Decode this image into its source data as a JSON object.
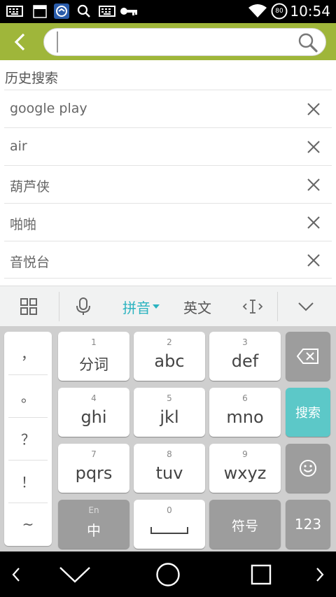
{
  "status_bar": {
    "time": "10:54",
    "battery_level": "80",
    "left_icons": [
      "keyboard-icon",
      "calendar-365-icon",
      "app-notification-icon",
      "search-icon",
      "keyboard-icon",
      "key-icon"
    ],
    "right_icons": [
      "wifi-icon",
      "battery-icon"
    ],
    "calendar_label": "365"
  },
  "header": {
    "bg_color": "#9fb63a",
    "search_value": "",
    "search_placeholder": ""
  },
  "history": {
    "title": "历史搜索",
    "items": [
      {
        "label": "google play"
      },
      {
        "label": "air"
      },
      {
        "label": "葫芦侠"
      },
      {
        "label": "啪啪"
      },
      {
        "label": "音悦台"
      }
    ]
  },
  "keyboard": {
    "toolbar": {
      "pinyin": "拼音",
      "english": "英文",
      "accent_color": "#2bb3c0"
    },
    "symbols": [
      "，",
      "。",
      "？",
      "！",
      "~"
    ],
    "keys": [
      {
        "num": "1",
        "label": "分词"
      },
      {
        "num": "2",
        "label": "abc"
      },
      {
        "num": "3",
        "label": "def"
      },
      {
        "num": "4",
        "label": "ghi"
      },
      {
        "num": "5",
        "label": "jkl"
      },
      {
        "num": "6",
        "label": "mno"
      },
      {
        "num": "7",
        "label": "pqrs"
      },
      {
        "num": "8",
        "label": "tuv"
      },
      {
        "num": "9",
        "label": "wxyz"
      }
    ],
    "bottom": {
      "lang_small": "En",
      "lang_main": "中",
      "space_num": "0",
      "symbols": "符号",
      "numbers": "123"
    },
    "search_key": "搜索",
    "search_key_color": "#5cc8c8"
  }
}
